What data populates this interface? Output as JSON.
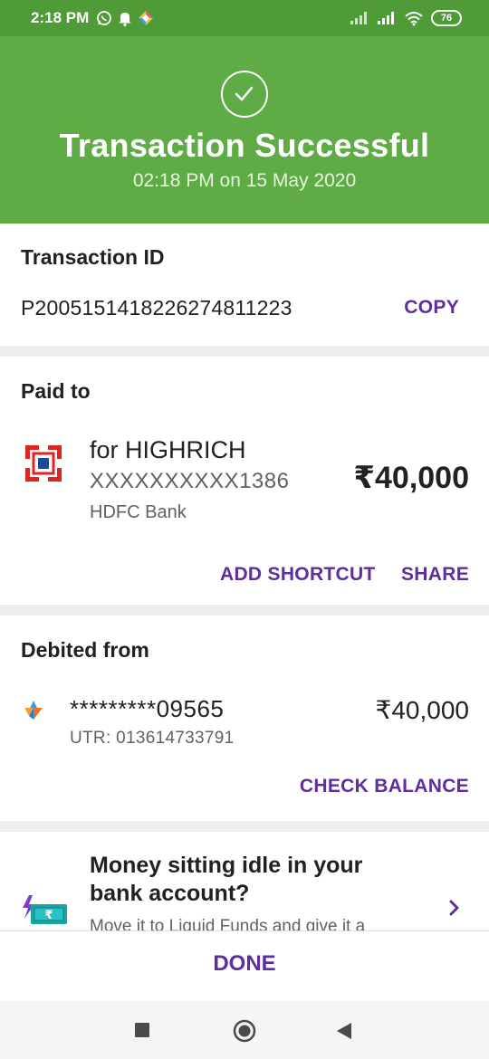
{
  "status_bar": {
    "time": "2:18 PM",
    "battery": "76",
    "icons": [
      "whatsapp-icon",
      "notification-bell-icon",
      "app-icon",
      "signal-icon",
      "signal-icon",
      "wifi-icon",
      "battery-icon"
    ]
  },
  "header": {
    "title": "Transaction Successful",
    "subtitle": "02:18 PM on 15 May 2020",
    "icon": "check-circle-icon",
    "color": "#5fac47"
  },
  "transaction": {
    "label": "Transaction ID",
    "id": "P2005151418226274811223",
    "copy_label": "COPY"
  },
  "paid_to": {
    "label": "Paid to",
    "name": "for HIGHRICH",
    "account": "XXXXXXXXXX1386",
    "bank": "HDFC Bank",
    "amount": "₹40,000",
    "add_shortcut_label": "ADD SHORTCUT",
    "share_label": "SHARE",
    "bank_logo": "hdfc-logo-icon"
  },
  "debited_from": {
    "label": "Debited from",
    "account": "*********09565",
    "utr": "UTR: 013614733791",
    "amount": "₹40,000",
    "check_balance_label": "CHECK BALANCE",
    "bank_logo": "bank-logo-icon"
  },
  "promo": {
    "title": "Money sitting idle in your bank account?",
    "description": "Move it to Liquid Funds and give it a",
    "icon": "rupee-note-icon"
  },
  "actions": {
    "done_label": "DONE"
  },
  "colors": {
    "accent": "#5e2d9e",
    "success": "#5fac47",
    "status_bar": "#4e9b38"
  }
}
